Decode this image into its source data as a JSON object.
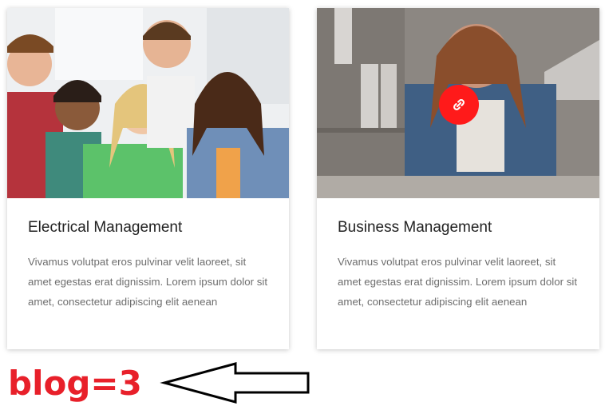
{
  "colors": {
    "accent": "#ff1a1a",
    "annotation": "#e8202a",
    "title": "#222222",
    "body_text": "#6e6e6e"
  },
  "cards": [
    {
      "title": "Electrical Management",
      "description": "Vivamus volutpat eros pulvinar velit laoreet, sit amet egestas erat dignissim. Lorem ipsum dolor sit amet, consectetur adipiscing elit aenean",
      "image": "group-of-smiling-students-photo"
    },
    {
      "title": "Business Management",
      "description": "Vivamus volutpat eros pulvinar velit laoreet, sit amet egestas erat dignissim. Lorem ipsum dolor sit amet, consectetur adipiscing elit aenean",
      "image": "woman-writing-at-desk-photo",
      "hover_icon": "link-icon"
    }
  ],
  "annotation": {
    "label": "blog=3",
    "arrow_icon": "left-arrow-icon"
  }
}
